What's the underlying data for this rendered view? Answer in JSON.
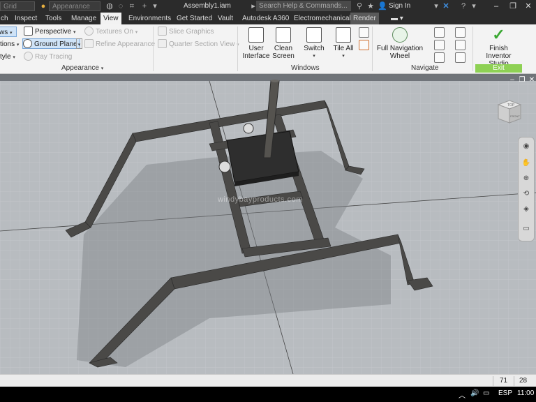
{
  "titlebar": {
    "field1_text": "Grid",
    "field2_text": "Appearance",
    "document_title": "Assembly1.iam",
    "search_placeholder": "Search Help & Commands...",
    "signin_label": "Sign In",
    "help_glyph": "?",
    "minimize_glyph": "–",
    "restore_glyph": "❐",
    "close_glyph": "✕"
  },
  "tabs": [
    {
      "label": "ch"
    },
    {
      "label": "Inspect"
    },
    {
      "label": "Tools"
    },
    {
      "label": "Manage"
    },
    {
      "label": "View"
    },
    {
      "label": "Environments"
    },
    {
      "label": "Get Started"
    },
    {
      "label": "Vault"
    },
    {
      "label": "Autodesk A360"
    },
    {
      "label": "Electromechanical"
    },
    {
      "label": "Render"
    }
  ],
  "ribbon": {
    "appearance": {
      "shadows_label": "ws",
      "reflections_label": "tions",
      "style_label": "tyle",
      "perspective_label": "Perspective",
      "ground_plane_label": "Ground Plane",
      "ray_tracing_label": "Ray Tracing",
      "textures_on_label": "Textures On",
      "refine_appearance_label": "Refine Appearance",
      "panel_label": "Appearance"
    },
    "slice": {
      "slice_graphics_label": "Slice Graphics",
      "quarter_section_label": "Quarter Section View"
    },
    "windows": {
      "user_interface_label_1": "User",
      "user_interface_label_2": "Interface",
      "clean_screen_label_1": "Clean",
      "clean_screen_label_2": "Screen",
      "switch_label": "Switch",
      "tile_all_label": "Tile All",
      "panel_label": "Windows"
    },
    "navigate": {
      "full_nav_wheel_label_1": "Full Navigation",
      "full_nav_wheel_label_2": "Wheel",
      "panel_label": "Navigate"
    },
    "exit": {
      "finish_label_1": "Finish",
      "finish_label_2": "Inventor Studio",
      "panel_label": "Exit"
    }
  },
  "viewport": {
    "watermark": "windybayproducts.com",
    "viewcube_top_label": "TOP",
    "viewcube_front_label": "FRONT"
  },
  "statusbar": {
    "value1": "71",
    "value2": "28"
  },
  "taskbar": {
    "language": "ESP",
    "time": "11:00"
  },
  "colors": {
    "titlebar_bg": "#2b2b2b",
    "ribbon_bg": "#f3f3f3",
    "exit_green": "#8ed154",
    "selection_blue": "#cfe3f7"
  }
}
